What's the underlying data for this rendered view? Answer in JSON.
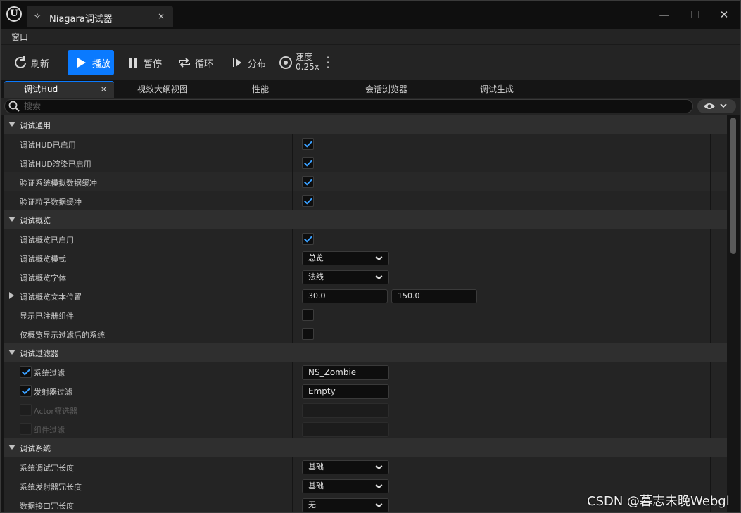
{
  "window": {
    "logo_text": "U",
    "tab_title": "Niagara调试器",
    "tab_close": "×",
    "min": "—",
    "max": "☐",
    "close": "✕"
  },
  "menubar": {
    "window_menu": "窗口"
  },
  "toolbar": {
    "refresh": "刷新",
    "play": "播放",
    "pause": "暂停",
    "loop": "循环",
    "distribute": "分布",
    "speed_label": "速度",
    "speed_value": "0.25x"
  },
  "tabs": [
    {
      "label": "调试Hud",
      "close": "×"
    },
    {
      "label": "视效大纲视图"
    },
    {
      "label": "性能"
    },
    {
      "label": "会话浏览器"
    },
    {
      "label": "调试生成"
    }
  ],
  "search": {
    "placeholder": "搜索"
  },
  "sections": {
    "general": {
      "title": "调试通用",
      "rows": [
        {
          "label": "调试HUD已启用",
          "checked": true
        },
        {
          "label": "调试HUD渲染已启用",
          "checked": true
        },
        {
          "label": "验证系统模拟数据缓冲",
          "checked": true
        },
        {
          "label": "验证粒子数据缓冲",
          "checked": true
        }
      ]
    },
    "overview": {
      "title": "调试概览",
      "enabled_label": "调试概览已启用",
      "mode_label": "调试概览模式",
      "mode_value": "总览",
      "font_label": "调试概览字体",
      "font_value": "法线",
      "pos_label": "调试概览文本位置",
      "pos_x": "30.0",
      "pos_y": "150.0",
      "show_components_label": "显示已注册组件",
      "filtered_only_label": "仅概览显示过滤后的系统"
    },
    "filters": {
      "title": "调试过滤器",
      "system_label": "系统过滤",
      "system_value": "NS_Zombie",
      "emitter_label": "发射器过滤",
      "emitter_value": "Empty",
      "actor_label": "Actor筛选器",
      "component_label": "组件过滤"
    },
    "system": {
      "title": "调试系统",
      "sys_verbosity_label": "系统调试冗长度",
      "sys_verbosity_value": "基础",
      "emitter_verbosity_label": "系统发射器冗长度",
      "emitter_verbosity_value": "基础",
      "di_verbosity_label": "数据接口冗长度",
      "di_verbosity_value": "无"
    }
  },
  "watermark": "CSDN @暮志未晚Webgl",
  "colors": {
    "accent": "#0a7aff",
    "check": "#3aa0ff",
    "panel": "#242424",
    "category": "#2f2f2f"
  }
}
